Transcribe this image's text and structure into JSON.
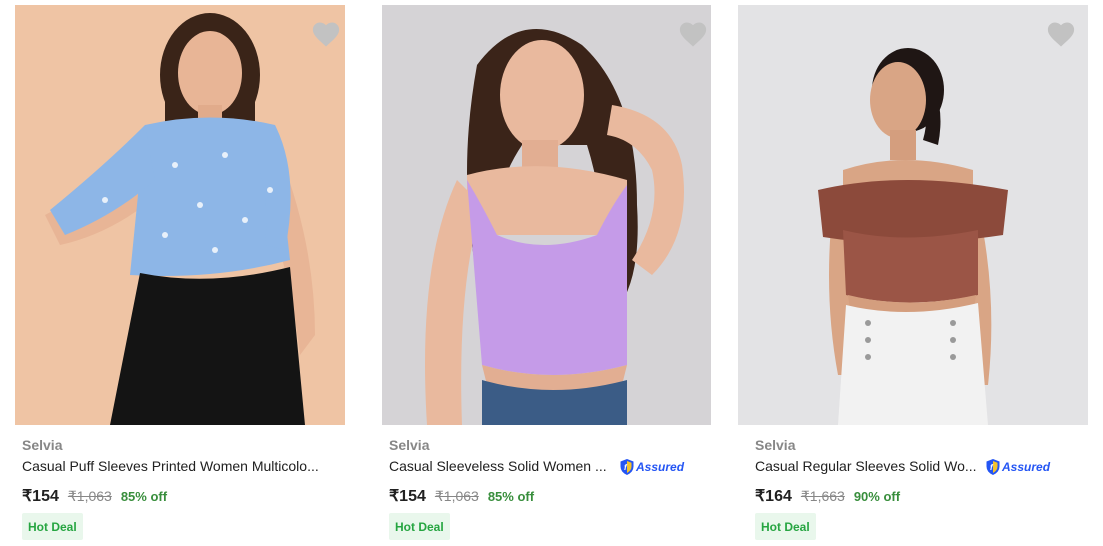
{
  "products": [
    {
      "brand": "Selvia",
      "title": "Casual Puff Sleeves Printed Women Multicolo...",
      "assured": false,
      "price": "₹154",
      "mrp": "₹1,063",
      "discount": "85% off",
      "badge": "Hot Deal",
      "image": "woman-blue-printed-top",
      "bg_color": "#f3c8aa"
    },
    {
      "brand": "Selvia",
      "title": "Casual Sleeveless Solid Women ...",
      "assured": true,
      "assured_label": "Assured",
      "price": "₹154",
      "mrp": "₹1,063",
      "discount": "85% off",
      "badge": "Hot Deal",
      "image": "woman-lavender-tank-top",
      "bg_color": "#d5d3d6"
    },
    {
      "brand": "Selvia",
      "title": "Casual Regular Sleeves Solid Wo...",
      "assured": true,
      "assured_label": "Assured",
      "price": "₹164",
      "mrp": "₹1,663",
      "discount": "90% off",
      "badge": "Hot Deal",
      "image": "woman-rust-off-shoulder-top",
      "bg_color": "#e3e3e5"
    }
  ],
  "icons": {
    "wishlist": "heart-icon",
    "assured": "assured-shield-icon"
  },
  "colors": {
    "discount": "#388e3c",
    "assured": "#2455f4",
    "badge_bg": "#e9f7ec",
    "badge_text": "#26a541",
    "wishlist": "#c2c2c2"
  }
}
